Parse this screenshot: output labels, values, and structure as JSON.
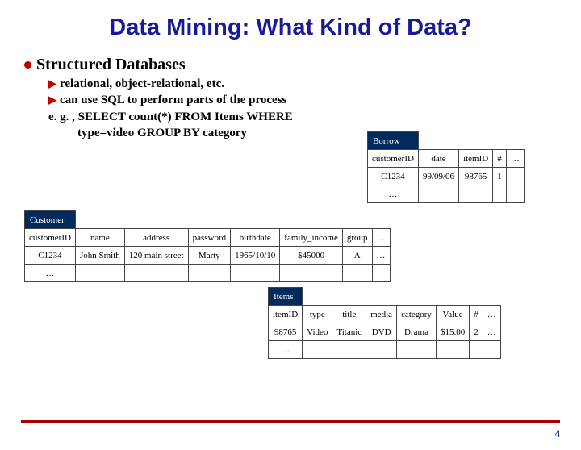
{
  "title": "Data Mining: What Kind of Data?",
  "main_bullet": "Structured Databases",
  "subs": {
    "a": "relational, object-relational, etc.",
    "b": "can use SQL to perform parts of the process"
  },
  "example_l1": "e. g. ,   SELECT count(*) FROM Items WHERE",
  "example_l2": "type=video GROUP BY category",
  "borrow": {
    "name": "Borrow",
    "hdr": {
      "c0": "customerID",
      "c1": "date",
      "c2": "itemID",
      "c3": "#",
      "c4": "…"
    },
    "r1": {
      "c0": "C1234",
      "c1": "99/09/06",
      "c2": "98765",
      "c3": "1",
      "c4": ""
    },
    "r2": {
      "c0": "…",
      "c1": "",
      "c2": "",
      "c3": "",
      "c4": ""
    }
  },
  "customer": {
    "name": "Customer",
    "hdr": {
      "c0": "customerID",
      "c1": "name",
      "c2": "address",
      "c3": "password",
      "c4": "birthdate",
      "c5": "family_income",
      "c6": "group",
      "c7": "…"
    },
    "r1": {
      "c0": "C1234",
      "c1": "John Smith",
      "c2": "120 main street",
      "c3": "Marty",
      "c4": "1965/10/10",
      "c5": "$45000",
      "c6": "A",
      "c7": "…"
    },
    "r2": {
      "c0": "…",
      "c1": "",
      "c2": "",
      "c3": "",
      "c4": "",
      "c5": "",
      "c6": "",
      "c7": ""
    }
  },
  "items": {
    "name": "Items",
    "hdr": {
      "c0": "itemID",
      "c1": "type",
      "c2": "title",
      "c3": "media",
      "c4": "category",
      "c5": "Value",
      "c6": "#",
      "c7": "…"
    },
    "r1": {
      "c0": "98765",
      "c1": "Video",
      "c2": "Titanic",
      "c3": "DVD",
      "c4": "Drama",
      "c5": "$15.00",
      "c6": "2",
      "c7": "…"
    },
    "r2": {
      "c0": "…",
      "c1": "",
      "c2": "",
      "c3": "",
      "c4": "",
      "c5": "",
      "c6": "",
      "c7": ""
    }
  },
  "page_number": "4"
}
